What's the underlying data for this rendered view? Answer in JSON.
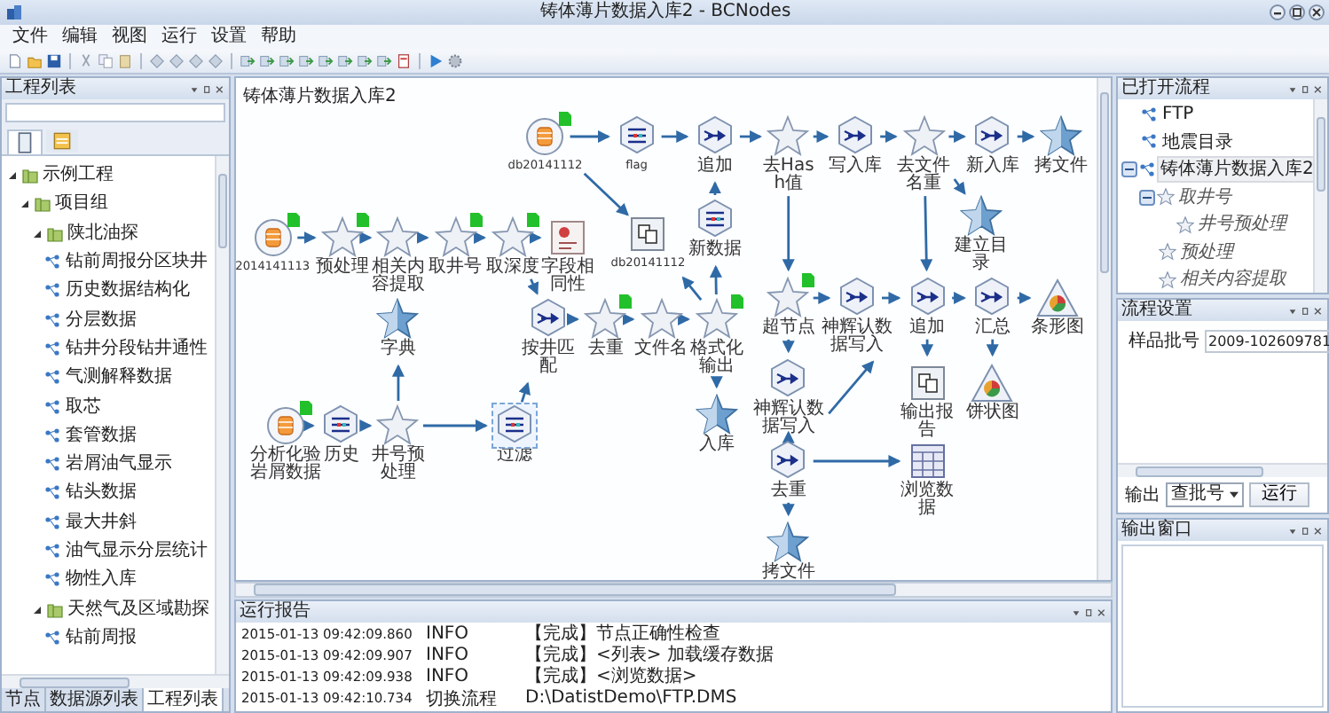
{
  "window": {
    "title": "铸体薄片数据入库2 - BCNodes"
  },
  "menu": [
    "文件",
    "编辑",
    "视图",
    "运行",
    "设置",
    "帮助"
  ],
  "project_panel": {
    "title": "工程列表",
    "tree": [
      {
        "label": "示例工程",
        "expanded": true,
        "children": [
          {
            "label": "项目组",
            "expanded": true,
            "children": [
              {
                "label": "陕北油探",
                "expanded": true,
                "children": [
                  {
                    "label": "钻前周报分区块井"
                  },
                  {
                    "label": "历史数据结构化"
                  },
                  {
                    "label": "分层数据"
                  },
                  {
                    "label": "钻井分段钻井通性"
                  },
                  {
                    "label": "气测解释数据"
                  },
                  {
                    "label": "取芯"
                  },
                  {
                    "label": "套管数据"
                  },
                  {
                    "label": "岩屑油气显示"
                  },
                  {
                    "label": "钻头数据"
                  },
                  {
                    "label": "最大井斜"
                  },
                  {
                    "label": "油气显示分层统计"
                  },
                  {
                    "label": "物性入库"
                  }
                ]
              },
              {
                "label": "天然气及区域勘探",
                "expanded": true,
                "children": [
                  {
                    "label": "钻前周报"
                  }
                ]
              }
            ]
          }
        ]
      }
    ],
    "tabs": [
      {
        "label": "节点",
        "selected": false
      },
      {
        "label": "数据源列表",
        "selected": false
      },
      {
        "label": "工程列表",
        "selected": true
      }
    ]
  },
  "canvas": {
    "title": "铸体薄片数据入库2",
    "nodes": [
      {
        "label": "db20141112",
        "kind": "database",
        "flag": true,
        "selected": false
      },
      {
        "label": "flag",
        "kind": "hex_split",
        "flag": false,
        "selected": false
      },
      {
        "label": "追加",
        "kind": "hex_merge",
        "flag": false,
        "selected": false
      },
      {
        "label": "去Hash值",
        "kind": "star",
        "flag": false,
        "selected": false
      },
      {
        "label": "写入库",
        "kind": "hex_merge",
        "flag": false,
        "selected": false
      },
      {
        "label": "去文件名重",
        "kind": "star",
        "flag": false,
        "selected": false
      },
      {
        "label": "新入库",
        "kind": "hex_merge",
        "flag": false,
        "selected": false
      },
      {
        "label": "拷文件",
        "kind": "star_blue",
        "flag": false,
        "selected": false
      },
      {
        "label": "2014141113",
        "kind": "database",
        "flag": true,
        "selected": false
      },
      {
        "label": "预处理",
        "kind": "star",
        "flag": true,
        "selected": false
      },
      {
        "label": "相关内容提取",
        "kind": "star",
        "flag": false,
        "selected": false
      },
      {
        "label": "取井号",
        "kind": "star",
        "flag": true,
        "selected": false
      },
      {
        "label": "取深度",
        "kind": "star",
        "flag": true,
        "selected": false
      },
      {
        "label": "字段相同性",
        "kind": "report",
        "flag": false,
        "selected": false
      },
      {
        "label": "db20141112",
        "kind": "box",
        "flag": false,
        "selected": false
      },
      {
        "label": "新数据",
        "kind": "hex_split",
        "flag": false,
        "selected": false
      },
      {
        "label": "建立目录",
        "kind": "star_blue",
        "flag": false,
        "selected": false
      },
      {
        "label": "字典",
        "kind": "star_blue",
        "flag": false,
        "selected": false
      },
      {
        "label": "按井匹配",
        "kind": "hex_merge",
        "flag": false,
        "selected": false
      },
      {
        "label": "去重",
        "kind": "star",
        "flag": true,
        "selected": false
      },
      {
        "label": "文件名",
        "kind": "star",
        "flag": false,
        "selected": false
      },
      {
        "label": "格式化输出",
        "kind": "star",
        "flag": true,
        "selected": false
      },
      {
        "label": "超节点",
        "kind": "star",
        "flag": true,
        "selected": false
      },
      {
        "label": "神辉认数据写入",
        "kind": "hex_merge",
        "flag": false,
        "selected": false
      },
      {
        "label": "追加",
        "kind": "hex_merge",
        "flag": false,
        "selected": false
      },
      {
        "label": "汇总",
        "kind": "hex_merge",
        "flag": false,
        "selected": false
      },
      {
        "label": "条形图",
        "kind": "chart",
        "flag": false,
        "selected": false
      },
      {
        "label": "分析化验岩屑数据",
        "kind": "database",
        "flag": true,
        "selected": false
      },
      {
        "label": "历史",
        "kind": "hex_split",
        "flag": false,
        "selected": false
      },
      {
        "label": "井号预处理",
        "kind": "star",
        "flag": false,
        "selected": false
      },
      {
        "label": "过滤",
        "kind": "hex_split",
        "flag": false,
        "selected": true
      },
      {
        "label": "入库",
        "kind": "star_blue",
        "flag": false,
        "selected": false
      },
      {
        "label": "神辉认数据写入",
        "kind": "hex_merge",
        "flag": false,
        "selected": false
      },
      {
        "label": "输出报告",
        "kind": "box",
        "flag": false,
        "selected": false
      },
      {
        "label": "饼状图",
        "kind": "chart",
        "flag": false,
        "selected": false
      },
      {
        "label": "去重",
        "kind": "hex_merge",
        "flag": false,
        "selected": false
      },
      {
        "label": "浏览数据",
        "kind": "table",
        "flag": false,
        "selected": false
      },
      {
        "label": "拷文件",
        "kind": "star_blue",
        "flag": false,
        "selected": false
      }
    ]
  },
  "log": {
    "title": "运行报告",
    "rows": [
      {
        "time": "2015-01-13 09:42:09.860",
        "level": "INFO",
        "message": "【完成】节点正确性检查"
      },
      {
        "time": "2015-01-13 09:42:09.907",
        "level": "INFO",
        "message": "【完成】<列表> 加载缓存数据"
      },
      {
        "time": "2015-01-13 09:42:09.938",
        "level": "INFO",
        "message": "【完成】<浏览数据>"
      },
      {
        "time": "2015-01-13 09:42:10.734",
        "level": "切换流程",
        "message": "D:\\DatistDemo\\FTP.DMS"
      }
    ]
  },
  "open_flows": {
    "title": "已打开流程",
    "tree": [
      {
        "label": "FTP",
        "selected": false
      },
      {
        "label": "地震目录",
        "selected": false
      },
      {
        "label": "铸体薄片数据入库2",
        "selected": true,
        "expanded": true,
        "children": [
          {
            "label": "取井号",
            "selected": false,
            "expanded": true,
            "children": [
              {
                "label": "井号预处理",
                "selected": false
              }
            ]
          },
          {
            "label": "预处理",
            "selected": false
          },
          {
            "label": "相关内容提取",
            "selected": false
          }
        ]
      }
    ]
  },
  "flow_settings": {
    "title": "流程设置",
    "field_label": "样品批号",
    "field_value": "2009-102609781",
    "output_label": "输出",
    "output_select": "查批号",
    "run_button": "运行"
  },
  "output_window": {
    "title": "输出窗口"
  }
}
